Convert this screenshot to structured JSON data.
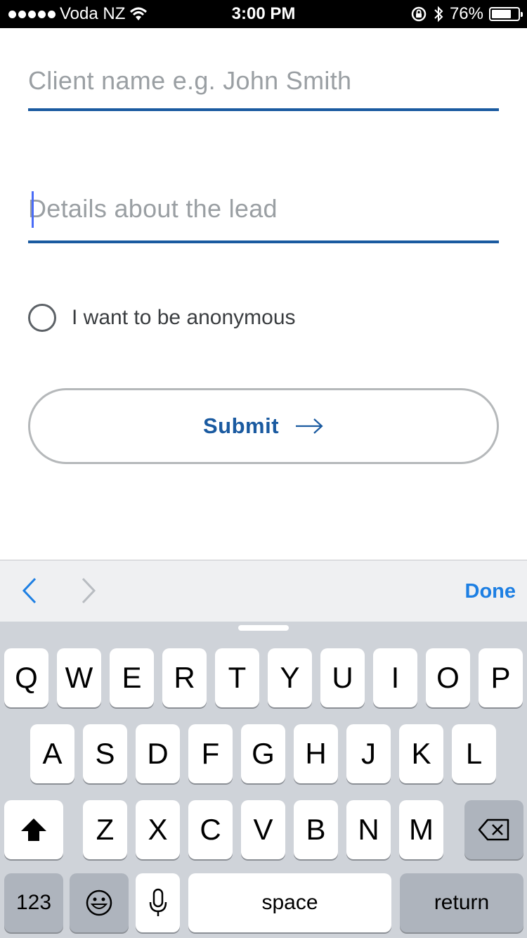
{
  "status_bar": {
    "carrier": "Voda NZ",
    "time": "3:00 PM",
    "battery": "76%",
    "battery_level": 0.76
  },
  "form": {
    "client_name_placeholder": "Client name e.g. John Smith",
    "details_placeholder": "Details about the lead",
    "anonymous_label": "I want to be anonymous",
    "submit_label": "Submit"
  },
  "accessory": {
    "done_label": "Done"
  },
  "keyboard": {
    "row1": [
      "Q",
      "W",
      "E",
      "R",
      "T",
      "Y",
      "U",
      "I",
      "O",
      "P"
    ],
    "row2": [
      "A",
      "S",
      "D",
      "F",
      "G",
      "H",
      "J",
      "K",
      "L"
    ],
    "row3": [
      "Z",
      "X",
      "C",
      "V",
      "B",
      "N",
      "M"
    ],
    "numbers_label": "123",
    "space_label": "space",
    "return_label": "return"
  },
  "colors": {
    "accent": "#1a5aa0",
    "done_blue": "#1d7fe3",
    "keyboard_bg": "#cfd3d9"
  }
}
